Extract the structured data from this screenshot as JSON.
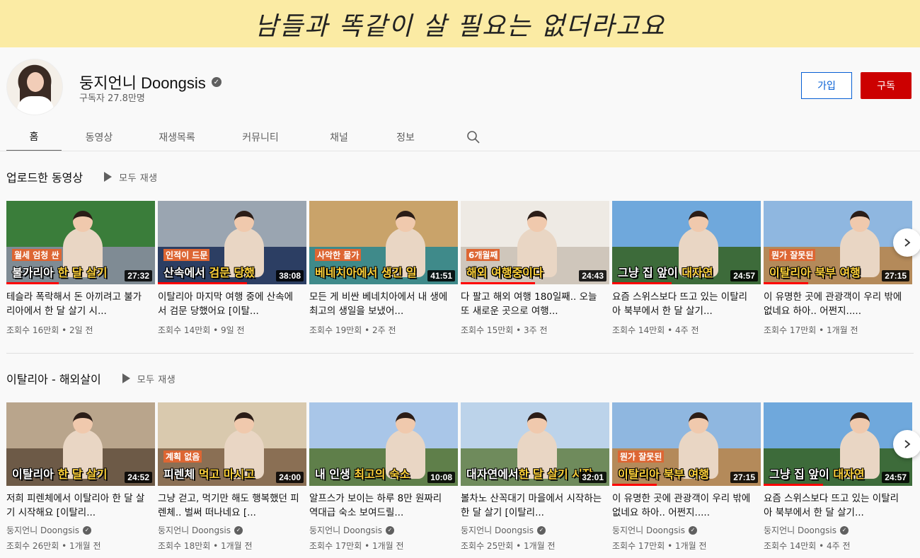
{
  "banner": {
    "text": "남들과 똑같이 살 필요는 없더라고요"
  },
  "channel": {
    "name": "둥지언니 Doongsis",
    "subscribers": "구독자 27.8만명",
    "join_label": "가입",
    "subscribe_label": "구독"
  },
  "tabs": [
    {
      "label": "홈",
      "active": true
    },
    {
      "label": "동영상"
    },
    {
      "label": "재생목록"
    },
    {
      "label": "커뮤니티"
    },
    {
      "label": "채널"
    },
    {
      "label": "정보"
    }
  ],
  "shelves": [
    {
      "title": "업로드한 동영상",
      "play_all": "모두 재생",
      "videos": [
        {
          "title": "테슬라 폭락해서 돈 아끼려고 불가리아에서 한 달 살기 시...",
          "meta": "조회수 16만회 • 2일 전",
          "duration": "27:32",
          "caption_top": "월세 엄청 싼",
          "caption_a": "불가리아 ",
          "caption_hl": "한 달 살기",
          "palette": [
            "#3a7d3a",
            "#7f8b94"
          ],
          "progress": 0.35
        },
        {
          "title": "이탈리아 마지막 여행 중에 산속에서 검문 당했어요 [이탈...",
          "meta": "조회수 14만회 • 9일 전",
          "duration": "38:08",
          "caption_top": "인적이 드문",
          "caption_a": "산속에서 ",
          "caption_hl": "검문 당했",
          "palette": [
            "#9aa5b1",
            "#2c3e63"
          ],
          "progress": 0.6
        },
        {
          "title": "모든 게 비싼 베네치아에서 내 생에 최고의 생일을 보냈어...",
          "meta": "조회수 19만회 • 2주 전",
          "duration": "41:51",
          "caption_top": "사악한 물가",
          "caption_a": "",
          "caption_hl": "베네치아에서 생긴 일",
          "palette": [
            "#c9a36a",
            "#3f8a8a"
          ],
          "progress": 0
        },
        {
          "title": "다 팔고 해외 여행 180일째.. 오늘 또 새로운 곳으로 여행...",
          "meta": "조회수 15만회 • 3주 전",
          "duration": "24:43",
          "caption_top": "6개월째",
          "caption_a": "",
          "caption_hl": "해외 여행중이다",
          "palette": [
            "#eeeae4",
            "#cfc6bb"
          ],
          "progress": 0.5
        },
        {
          "title": "요즘 스위스보다 뜨고 있는 이탈리아 북부에서 한 달 살기...",
          "meta": "조회수 14만회 • 4주 전",
          "duration": "24:57",
          "caption_top": "",
          "caption_a": "그냥 집 앞이 ",
          "caption_hl": "대자연",
          "palette": [
            "#6fa8dc",
            "#3d6b3a"
          ],
          "progress": 0.4
        },
        {
          "title": "이 유명한 곳에 관광객이 우리 밖에 없네요 하아.. 어쩐지.....",
          "meta": "조회수 17만회 • 1개월 전",
          "duration": "27:15",
          "caption_top": "뭔가 잘못된",
          "caption_a": "",
          "caption_hl": "이탈리아 북부 여행",
          "palette": [
            "#8fb7e0",
            "#b48a5a"
          ],
          "progress": 0.3
        }
      ]
    },
    {
      "title": "이탈리아 - 해외살이",
      "play_all": "모두 재생",
      "videos": [
        {
          "title": "저희 피렌체에서 이탈리아 한 달 살기 시작해요 [이탈리...",
          "channel": "둥지언니 Doongsis",
          "meta": "조회수 26만회 • 1개월 전",
          "duration": "24:52",
          "caption_top": "",
          "caption_a": "이탈리아 ",
          "caption_hl": "한 달 살기",
          "palette": [
            "#b9a58c",
            "#6d5a47"
          ],
          "progress": 0
        },
        {
          "title": "그냥 걷고, 먹기만 해도 행복했던 피렌체.. 벌써 떠나네요 [...",
          "channel": "둥지언니 Doongsis",
          "meta": "조회수 18만회 • 1개월 전",
          "duration": "24:00",
          "caption_top": "계획 없음",
          "caption_a": "피렌체 ",
          "caption_hl": "먹고 마시고",
          "palette": [
            "#d9c9ae",
            "#8a6f54"
          ],
          "progress": 0
        },
        {
          "title": "알프스가 보이는 하루 8만 원짜리 역대급 숙소 보여드릴...",
          "channel": "둥지언니 Doongsis",
          "meta": "조회수 17만회 • 1개월 전",
          "duration": "10:08",
          "caption_top": "",
          "caption_a": "내 인생 ",
          "caption_hl": "최고의 숙소",
          "palette": [
            "#a9c6e8",
            "#5f7f4a"
          ],
          "progress": 0
        },
        {
          "title": "볼차노 산꼭대기 마을에서 시작하는 한 달 살기 [이탈리...",
          "channel": "둥지언니 Doongsis",
          "meta": "조회수 25만회 • 1개월 전",
          "duration": "32:01",
          "caption_top": "",
          "caption_a": "대자연에서",
          "caption_hl": "한 달 살기 시작",
          "palette": [
            "#bcd3ea",
            "#6f8b5c"
          ],
          "progress": 0
        },
        {
          "title": "이 유명한 곳에 관광객이 우리 밖에 없네요 하아.. 어쩐지.....",
          "channel": "둥지언니 Doongsis",
          "meta": "조회수 17만회 • 1개월 전",
          "duration": "27:15",
          "caption_top": "뭔가 잘못된",
          "caption_a": "",
          "caption_hl": "이탈리아 북부 여행",
          "palette": [
            "#8fb7e0",
            "#b48a5a"
          ],
          "progress": 0.3
        },
        {
          "title": "요즘 스위스보다 뜨고 있는 이탈리아 북부에서 한 달 살기...",
          "channel": "둥지언니 Doongsis",
          "meta": "조회수 14만회 • 4주 전",
          "duration": "24:57",
          "caption_top": "",
          "caption_a": "그냥 집 앞이 ",
          "caption_hl": "대자연",
          "palette": [
            "#6fa8dc",
            "#3d6b3a"
          ],
          "progress": 0.4
        }
      ]
    }
  ],
  "icons": {
    "search": "search-icon",
    "next": "chevron-right-icon",
    "play": "play-icon",
    "verified": "verified-icon"
  }
}
